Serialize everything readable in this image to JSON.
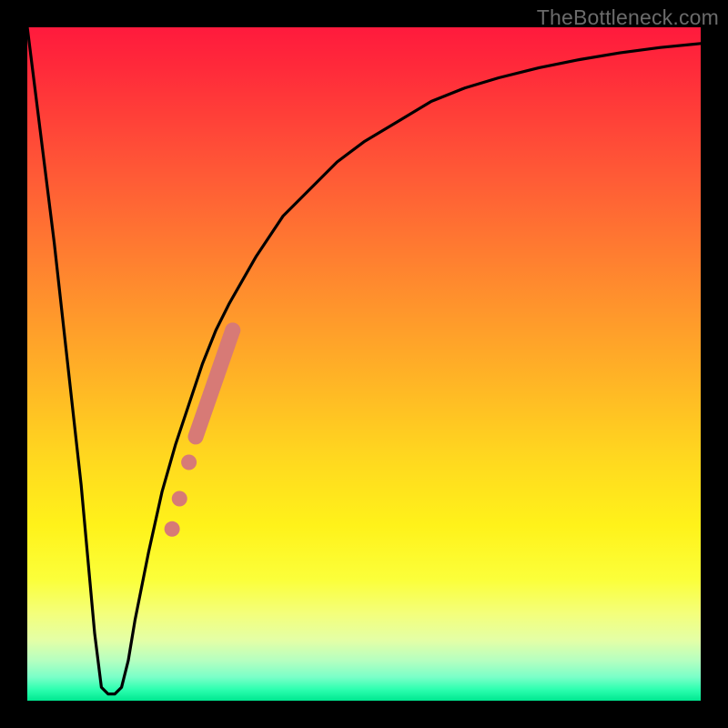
{
  "watermark": "TheBottleneck.com",
  "colors": {
    "frame": "#000000",
    "curve": "#000000",
    "marker": "#d77a76",
    "gradient_top": "#ff1a3d",
    "gradient_mid": "#ffd81f",
    "gradient_bottom": "#00e890"
  },
  "chart_data": {
    "type": "line",
    "title": "",
    "xlabel": "",
    "ylabel": "",
    "xlim": [
      0,
      100
    ],
    "ylim": [
      0,
      100
    ],
    "grid": false,
    "series": [
      {
        "name": "bottleneck-curve",
        "x": [
          0,
          4,
          8,
          10,
          11,
          12,
          13,
          14,
          15,
          16,
          18,
          20,
          22,
          24,
          26,
          28,
          30,
          34,
          38,
          42,
          46,
          50,
          55,
          60,
          65,
          70,
          76,
          82,
          88,
          94,
          100
        ],
        "values": [
          100,
          68,
          32,
          10,
          2,
          1,
          1,
          2,
          6,
          12,
          22,
          31,
          38,
          44,
          50,
          55,
          59,
          66,
          72,
          76,
          80,
          83,
          86,
          89,
          91,
          92.5,
          94,
          95.2,
          96.2,
          97,
          97.6
        ]
      }
    ],
    "markers": {
      "name": "highlight-segment",
      "points": [
        {
          "x": 21.5,
          "y": 25.5
        },
        {
          "x": 22.6,
          "y": 30.0
        },
        {
          "x": 24.0,
          "y": 35.4
        },
        {
          "x": 30.5,
          "y": 55.0
        }
      ],
      "segment": {
        "x1": 25.0,
        "y1": 39.2,
        "x2": 30.5,
        "y2": 55.0
      }
    }
  }
}
